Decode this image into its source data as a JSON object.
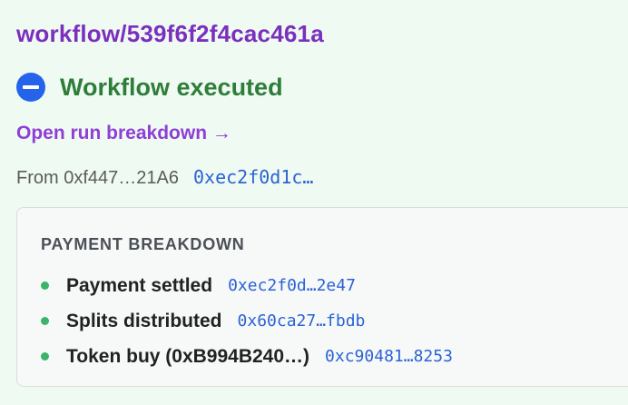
{
  "header": {
    "workflow_link": "workflow/539f6f2f4cac461a"
  },
  "status": {
    "icon": "minus-circle-icon",
    "text": "Workflow executed",
    "color": "#2f7d3b",
    "icon_color": "#2563eb"
  },
  "breakdown_link": {
    "label": "Open run breakdown →"
  },
  "from": {
    "label": "From 0xf447…21A6",
    "hash": "0xec2f0d1c…"
  },
  "payment_breakdown": {
    "title": "PAYMENT BREAKDOWN",
    "items": [
      {
        "label": "Payment settled",
        "hash": "0xec2f0d…2e47"
      },
      {
        "label": "Splits distributed",
        "hash": "0x60ca27…fbdb"
      },
      {
        "label": "Token buy (0xB994B240…)",
        "hash": "0xc90481…8253"
      }
    ]
  },
  "colors": {
    "background": "#effbf2",
    "accent_purple": "#7b2fbe",
    "link_blue": "#2b62d4",
    "bullet_green": "#3bb36a"
  }
}
